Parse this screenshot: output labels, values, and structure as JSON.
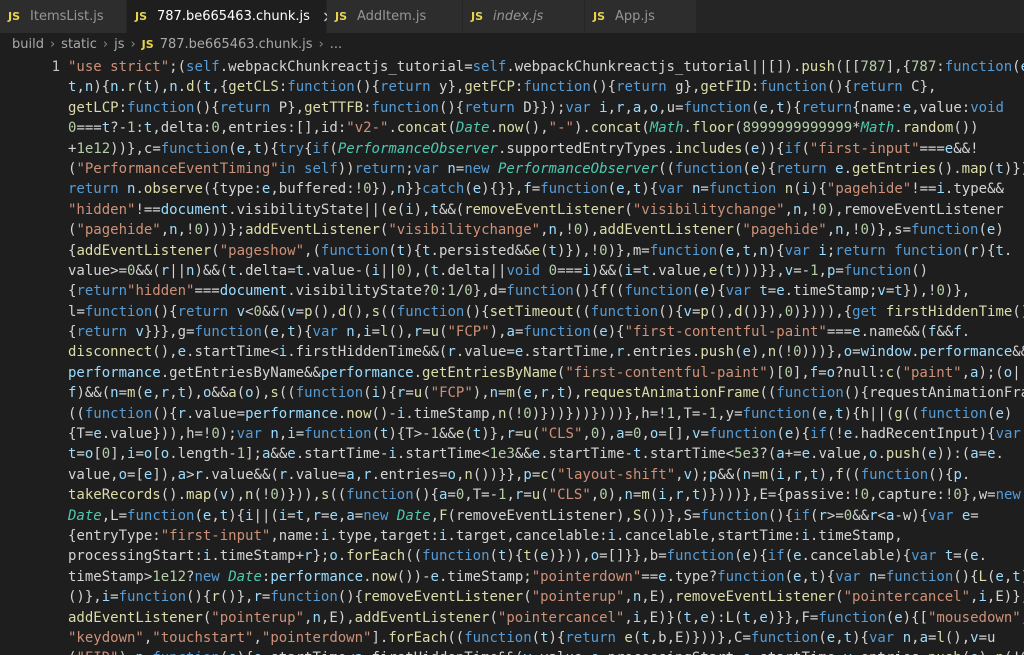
{
  "tabs": [
    {
      "label": "ItemsList.js",
      "active": false,
      "italic": false
    },
    {
      "label": "787.be665463.chunk.js",
      "active": true,
      "italic": false,
      "close": "×"
    },
    {
      "label": "AddItem.js",
      "active": false,
      "italic": false
    },
    {
      "label": "index.js",
      "active": false,
      "italic": true
    },
    {
      "label": "App.js",
      "active": false,
      "italic": false
    }
  ],
  "tab_icon_text": "JS",
  "breadcrumb": {
    "parts": [
      "build",
      "static",
      "js"
    ],
    "file": "787.be665463.chunk.js",
    "tail": "..."
  },
  "editor": {
    "line_number": "1",
    "lines": [
      "\"use strict\";(self.webpackChunkreactjs_tutorial=self.webpackChunkreactjs_tutorial||[]).push([[787],{787:function(e,",
      "t,n){n.r(t),n.d(t,{getCLS:function(){return y},getFCP:function(){return g},getFID:function(){return C},",
      "getLCP:function(){return P},getTTFB:function(){return D}});var i,r,a,o,u=function(e,t){return{name:e,value:void",
      "0===t?-1:t,delta:0,entries:[],id:\"v2-\".concat(Date.now(),\"-\").concat(Math.floor(8999999999999*Math.random())",
      "+1e12))},c=function(e,t){try{if(PerformanceObserver.supportedEntryTypes.includes(e)){if(\"first-input\"===e&&!",
      "(\"PerformanceEventTiming\"in self))return;var n=new PerformanceObserver((function(e){return e.getEntries().map(t)}));",
      "return n.observe({type:e,buffered:!0}),n}}catch(e){}},f=function(e,t){var n=function n(i){\"pagehide\"!==i.type&&",
      "\"hidden\"!==document.visibilityState||(e(i),t&&(removeEventListener(\"visibilitychange\",n,!0),removeEventListener",
      "(\"pagehide\",n,!0)))};addEventListener(\"visibilitychange\",n,!0),addEventListener(\"pagehide\",n,!0)},s=function(e)",
      "{addEventListener(\"pageshow\",(function(t){t.persisted&&e(t)}),!0)},m=function(e,t,n){var i;return function(r){t.",
      "value>=0&&(r||n)&&(t.delta=t.value-(i||0),(t.delta||void 0===i)&&(i=t.value,e(t)))}},v=-1,p=function()",
      "{return\"hidden\"===document.visibilityState?0:1/0},d=function(){f((function(e){var t=e.timeStamp;v=t}),!0)},",
      "l=function(){return v<0&&(v=p(),d(),s((function(){setTimeout((function(){v=p(),d()}),0)}))),{get firstHiddenTime()",
      "{return v}}},g=function(e,t){var n,i=l(),r=u(\"FCP\"),a=function(e){\"first-contentful-paint\"===e.name&&(f&&f.",
      "disconnect(),e.startTime<i.firstHiddenTime&&(r.value=e.startTime,r.entries.push(e),n(!0)))},o=window.performance&&",
      "performance.getEntriesByName&&performance.getEntriesByName(\"first-contentful-paint\")[0],f=o?null:c(\"paint\",a);(o||",
      "f)&&(n=m(e,r,t),o&&a(o),s((function(i){r=u(\"FCP\"),n=m(e,r,t),requestAnimationFrame((function(){requestAnimationFrame",
      "((function(){r.value=performance.now()-i.timeStamp,n(!0)}))}))})))},h=!1,T=-1,y=function(e,t){h||(g((function(e)",
      "{T=e.value})),h=!0);var n,i=function(t){T>-1&&e(t)},r=u(\"CLS\",0),a=0,o=[],v=function(e){if(!e.hadRecentInput){var",
      "t=o[0],i=o[o.length-1];a&&e.startTime-i.startTime<1e3&&e.startTime-t.startTime<5e3?(a+=e.value,o.push(e)):(a=e.",
      "value,o=[e]),a>r.value&&(r.value=a,r.entries=o,n())}},p=c(\"layout-shift\",v);p&&(n=m(i,r,t),f((function(){p.",
      "takeRecords().map(v),n(!0)})),s((function(){a=0,T=-1,r=u(\"CLS\",0),n=m(i,r,t)})))},E={passive:!0,capture:!0},w=new",
      "Date,L=function(e,t){i||(i=t,r=e,a=new Date,F(removeEventListener),S())},S=function(){if(r>=0&&r<a-w){var e=",
      "{entryType:\"first-input\",name:i.type,target:i.target,cancelable:i.cancelable,startTime:i.timeStamp,",
      "processingStart:i.timeStamp+r};o.forEach((function(t){t(e)})),o=[]}},b=function(e){if(e.cancelable){var t=(e.",
      "timeStamp>1e12?new Date:performance.now())-e.timeStamp;\"pointerdown\"==e.type?function(e,t){var n=function(){L(e,t),r",
      "()},i=function(){r()},r=function(){removeEventListener(\"pointerup\",n,E),removeEventListener(\"pointercancel\",i,E)};",
      "addEventListener(\"pointerup\",n,E),addEventListener(\"pointercancel\",i,E)}(t,e):L(t,e)}},F=function(e){[\"mousedown\",",
      "\"keydown\",\"touchstart\",\"pointerdown\"].forEach((function(t){return e(t,b,E)}))},C=function(e,t){var n,a=l(),v=u",
      "(\"FID\"),p=function(e){e.startTime<a.firstHiddenTime&&(v.value=e.processingStart-e.startTime,v.entries.push(e),n(!0))"
    ]
  },
  "colors": {
    "string": "#ce9178",
    "function": "#dcdcaa",
    "keyword": "#569cd6",
    "variable": "#9cdcfe",
    "class": "#4ec9b0",
    "number": "#b5cea8",
    "js_icon": "#e8d44d"
  }
}
